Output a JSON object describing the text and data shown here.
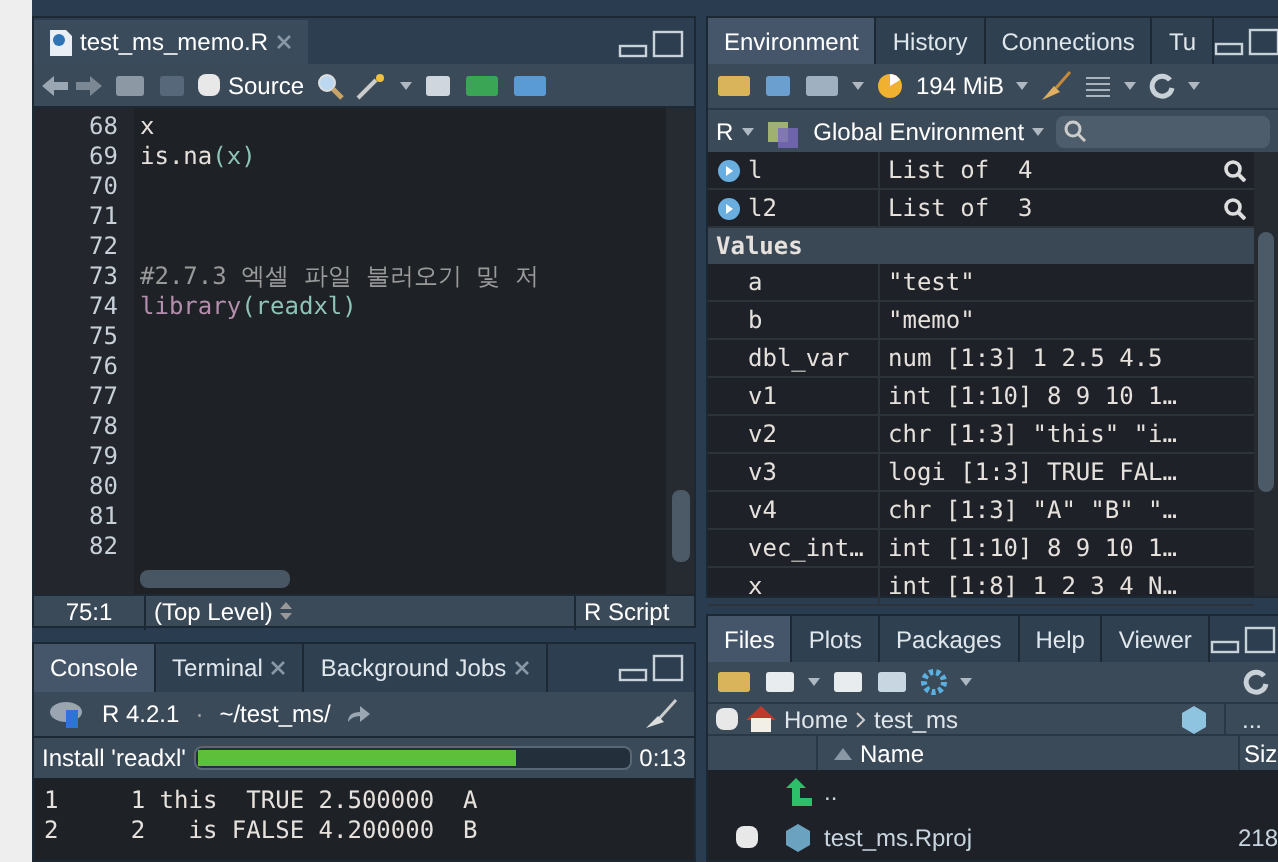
{
  "editor": {
    "tabs": [
      {
        "title": "test_ms_memo.R",
        "selected": true
      }
    ],
    "toolbar": {
      "source_label": "Source",
      "source_on_save": false
    },
    "lines": [
      {
        "number": "68",
        "tokens": [
          {
            "text": "x",
            "kind": "plain"
          }
        ]
      },
      {
        "number": "69",
        "tokens": [
          {
            "text": "is.na",
            "kind": "plain"
          },
          {
            "text": "(x)",
            "kind": "paren"
          }
        ]
      },
      {
        "number": "70"
      },
      {
        "number": "71"
      },
      {
        "number": "72"
      },
      {
        "number": "73",
        "tokens": [
          {
            "text": "#2.7.3 엑셀 파일 불러오기 및 저",
            "kind": "comment"
          }
        ]
      },
      {
        "number": "74",
        "tokens": [
          {
            "text": "library",
            "kind": "keyword"
          },
          {
            "text": "(readxl)",
            "kind": "paren"
          }
        ]
      },
      {
        "number": "75"
      },
      {
        "number": "76"
      },
      {
        "number": "77"
      },
      {
        "number": "78"
      },
      {
        "number": "79"
      },
      {
        "number": "80"
      },
      {
        "number": "81"
      },
      {
        "number": "82"
      }
    ],
    "status": {
      "position": "75:1",
      "scope": "(Top Level)",
      "filetype": "R Script"
    }
  },
  "console": {
    "tabs": [
      {
        "label": "Console",
        "selected": true,
        "closable": false
      },
      {
        "label": "Terminal",
        "selected": false,
        "closable": true
      },
      {
        "label": "Background Jobs",
        "selected": false,
        "closable": true
      }
    ],
    "version": "R 4.2.1",
    "separator": "·",
    "path": "~/test_ms/",
    "progress": {
      "label": "Install 'readxl'",
      "level": 0.74,
      "time": "0:13"
    },
    "output": [
      "1     1 this  TRUE 2.500000  A",
      "2     2   is FALSE 4.200000  B"
    ]
  },
  "environment": {
    "tabs": [
      {
        "label": "Environment",
        "selected": true
      },
      {
        "label": "History",
        "selected": false
      },
      {
        "label": "Connections",
        "selected": false
      },
      {
        "label": "Tu",
        "selected": false
      }
    ],
    "memory": "194 MiB",
    "language": "R",
    "scope": "Global Environment",
    "rows": [
      {
        "kind": "list",
        "name": "l",
        "value": "List of  4"
      },
      {
        "kind": "list",
        "name": "l2",
        "value": "List of  3"
      },
      {
        "kind": "header",
        "name": "Values"
      },
      {
        "kind": "value",
        "name": "a",
        "value": "\"test\""
      },
      {
        "kind": "value",
        "name": "b",
        "value": "\"memo\""
      },
      {
        "kind": "value",
        "name": "dbl_var",
        "value": "num [1:3] 1 2.5 4.5"
      },
      {
        "kind": "value",
        "name": "v1",
        "value": "int [1:10] 8 9 10 1…"
      },
      {
        "kind": "value",
        "name": "v2",
        "value": "chr [1:3] \"this\" \"i…"
      },
      {
        "kind": "value",
        "name": "v3",
        "value": "logi [1:3] TRUE FAL…"
      },
      {
        "kind": "value",
        "name": "v4",
        "value": "chr [1:3] \"A\" \"B\" \"…"
      },
      {
        "kind": "value",
        "name": "vec_int…",
        "value": "int [1:10] 8 9 10 1…"
      },
      {
        "kind": "value",
        "name": "x",
        "value": "int [1:8] 1 2 3 4 N…"
      }
    ]
  },
  "files": {
    "tabs": [
      {
        "label": "Files",
        "selected": true
      },
      {
        "label": "Plots",
        "selected": false
      },
      {
        "label": "Packages",
        "selected": false
      },
      {
        "label": "Help",
        "selected": false
      },
      {
        "label": "Viewer",
        "selected": false
      }
    ],
    "select_all_checked": false,
    "breadcrumb": [
      "Home",
      "test_ms"
    ],
    "more": "...",
    "columns": [
      "Name",
      "Siz"
    ],
    "rows": [
      {
        "kind": "parent",
        "name": ".."
      },
      {
        "kind": "rproj",
        "name": "test_ms.Rproj",
        "size": "218",
        "checked": false
      }
    ]
  }
}
